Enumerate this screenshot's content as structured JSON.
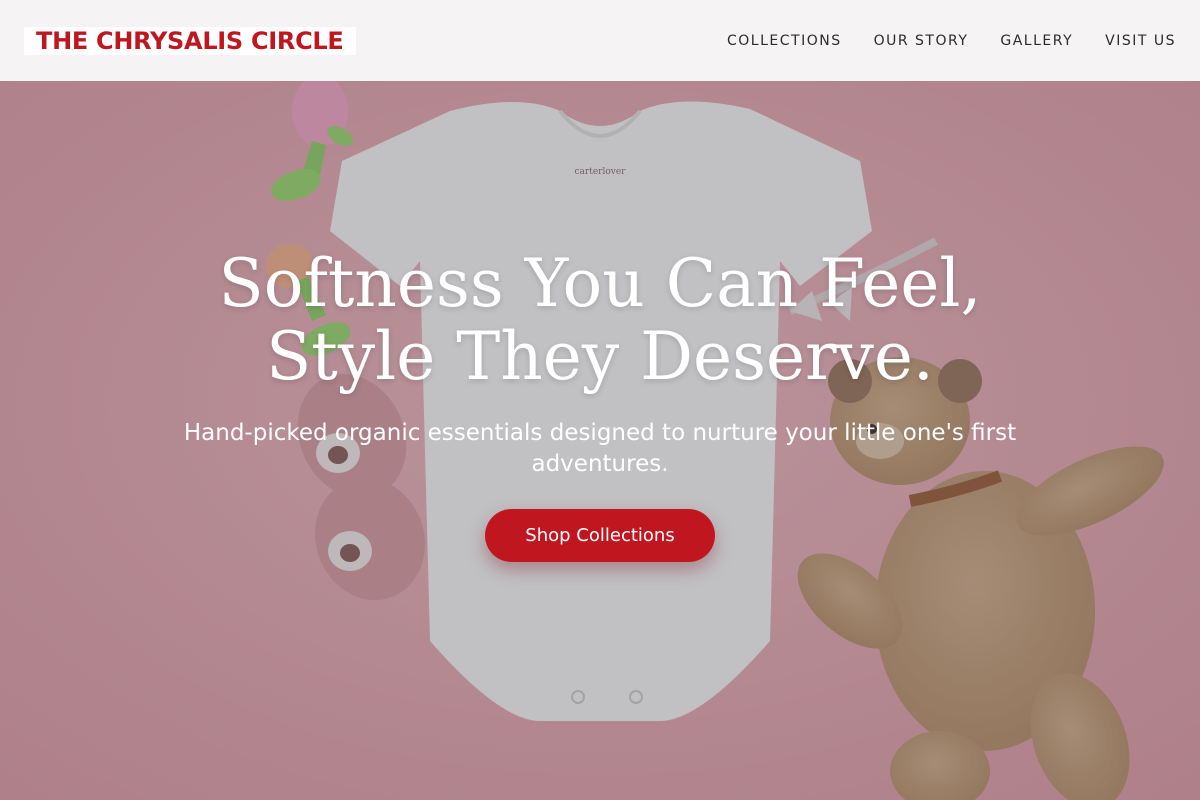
{
  "brand": {
    "name": "THE CHRYSALIS CIRCLE",
    "color": "#c0161f"
  },
  "nav": {
    "items": [
      {
        "label": "COLLECTIONS"
      },
      {
        "label": "OUR STORY"
      },
      {
        "label": "GALLERY"
      },
      {
        "label": "VISIT US"
      }
    ]
  },
  "hero": {
    "title": "Softness You Can Feel, Style They Deserve.",
    "subtitle": "Hand-picked organic essentials designed to nurture your little one's first adventures.",
    "cta_label": "Shop Collections",
    "image_subject": "baby onesie, teether toys, baby booties and a teddy bear on a pink background",
    "onesie_tag": "carterlover",
    "cta_color": "#c0161f",
    "background_color": "#e8a9b1"
  }
}
